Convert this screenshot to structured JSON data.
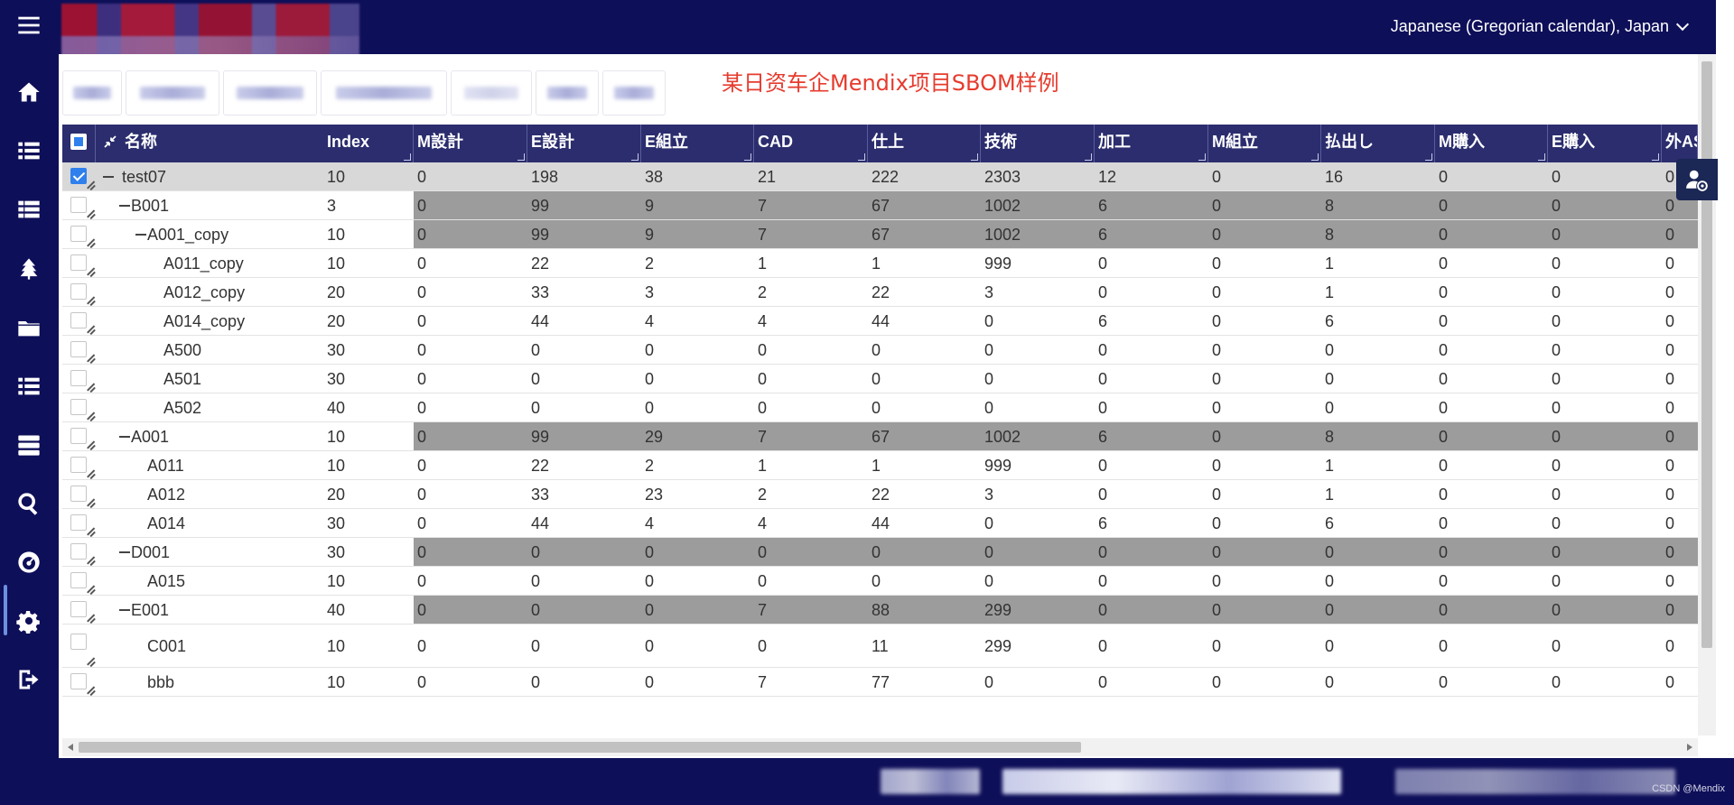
{
  "header": {
    "locale_label": "Japanese (Gregorian calendar), Japan"
  },
  "page": {
    "title": "某日资车企Mendix项目SBOM样例"
  },
  "grid": {
    "columns": [
      "名称",
      "Index",
      "M設計",
      "E設計",
      "E組立",
      "CAD",
      "仕上",
      "技術",
      "加工",
      "M組立",
      "払出し",
      "M購入",
      "E購入",
      "外ASSY"
    ],
    "rows": [
      {
        "name": "test07",
        "index": "10",
        "vals": [
          "0",
          "198",
          "38",
          "21",
          "222",
          "2303",
          "12",
          "0",
          "16",
          "0",
          "0",
          "0"
        ],
        "checked": true
      },
      {
        "name": "B001",
        "index": "3",
        "vals": [
          "0",
          "99",
          "9",
          "7",
          "67",
          "1002",
          "6",
          "0",
          "8",
          "0",
          "0",
          "0"
        ]
      },
      {
        "name": "A001_copy",
        "index": "10",
        "vals": [
          "0",
          "99",
          "9",
          "7",
          "67",
          "1002",
          "6",
          "0",
          "8",
          "0",
          "0",
          "0"
        ]
      },
      {
        "name": "A011_copy",
        "index": "10",
        "vals": [
          "0",
          "22",
          "2",
          "1",
          "1",
          "999",
          "0",
          "0",
          "1",
          "0",
          "0",
          "0"
        ]
      },
      {
        "name": "A012_copy",
        "index": "20",
        "vals": [
          "0",
          "33",
          "3",
          "2",
          "22",
          "3",
          "0",
          "0",
          "1",
          "0",
          "0",
          "0"
        ]
      },
      {
        "name": "A014_copy",
        "index": "20",
        "vals": [
          "0",
          "44",
          "4",
          "4",
          "44",
          "0",
          "6",
          "0",
          "6",
          "0",
          "0",
          "0"
        ]
      },
      {
        "name": "A500",
        "index": "30",
        "vals": [
          "0",
          "0",
          "0",
          "0",
          "0",
          "0",
          "0",
          "0",
          "0",
          "0",
          "0",
          "0"
        ]
      },
      {
        "name": "A501",
        "index": "30",
        "vals": [
          "0",
          "0",
          "0",
          "0",
          "0",
          "0",
          "0",
          "0",
          "0",
          "0",
          "0",
          "0"
        ]
      },
      {
        "name": "A502",
        "index": "40",
        "vals": [
          "0",
          "0",
          "0",
          "0",
          "0",
          "0",
          "0",
          "0",
          "0",
          "0",
          "0",
          "0"
        ]
      },
      {
        "name": "A001",
        "index": "10",
        "vals": [
          "0",
          "99",
          "29",
          "7",
          "67",
          "1002",
          "6",
          "0",
          "8",
          "0",
          "0",
          "0"
        ]
      },
      {
        "name": "A011",
        "index": "10",
        "vals": [
          "0",
          "22",
          "2",
          "1",
          "1",
          "999",
          "0",
          "0",
          "1",
          "0",
          "0",
          "0"
        ]
      },
      {
        "name": "A012",
        "index": "20",
        "vals": [
          "0",
          "33",
          "23",
          "2",
          "22",
          "3",
          "0",
          "0",
          "1",
          "0",
          "0",
          "0"
        ]
      },
      {
        "name": "A014",
        "index": "30",
        "vals": [
          "0",
          "44",
          "4",
          "4",
          "44",
          "0",
          "6",
          "0",
          "6",
          "0",
          "0",
          "0"
        ]
      },
      {
        "name": "D001",
        "index": "30",
        "vals": [
          "0",
          "0",
          "0",
          "0",
          "0",
          "0",
          "0",
          "0",
          "0",
          "0",
          "0",
          "0"
        ]
      },
      {
        "name": "A015",
        "index": "10",
        "vals": [
          "0",
          "0",
          "0",
          "0",
          "0",
          "0",
          "0",
          "0",
          "0",
          "0",
          "0",
          "0"
        ]
      },
      {
        "name": "E001",
        "index": "40",
        "vals": [
          "0",
          "0",
          "0",
          "7",
          "88",
          "299",
          "0",
          "0",
          "0",
          "0",
          "0",
          "0"
        ]
      },
      {
        "name": "C001",
        "index": "10",
        "vals": [
          "0",
          "0",
          "0",
          "0",
          "11",
          "299",
          "0",
          "0",
          "0",
          "0",
          "0",
          "0"
        ]
      },
      {
        "name": "bbb",
        "index": "10",
        "vals": [
          "0",
          "0",
          "0",
          "7",
          "77",
          "0",
          "0",
          "0",
          "0",
          "0",
          "0",
          "0"
        ]
      }
    ]
  },
  "footer": {
    "watermark": "CSDN @Mendix"
  },
  "colors": {
    "nav_bg": "#0e0f59",
    "header_bg": "#2b2d6e",
    "group_row_bg": "#9c9c9c",
    "selected_row_bg": "#d8d8d8",
    "title_red": "#e63b2e",
    "checkbox_blue": "#2f80ed"
  },
  "icons": [
    "menu-icon",
    "home-icon",
    "list-icon",
    "table-icon",
    "tree-icon",
    "folder-icon",
    "list-alt-icon",
    "server-icon",
    "search-icon",
    "dashboard-icon",
    "gear-icon",
    "logout-icon",
    "user-settings-icon",
    "collapse-arrows-icon"
  ]
}
